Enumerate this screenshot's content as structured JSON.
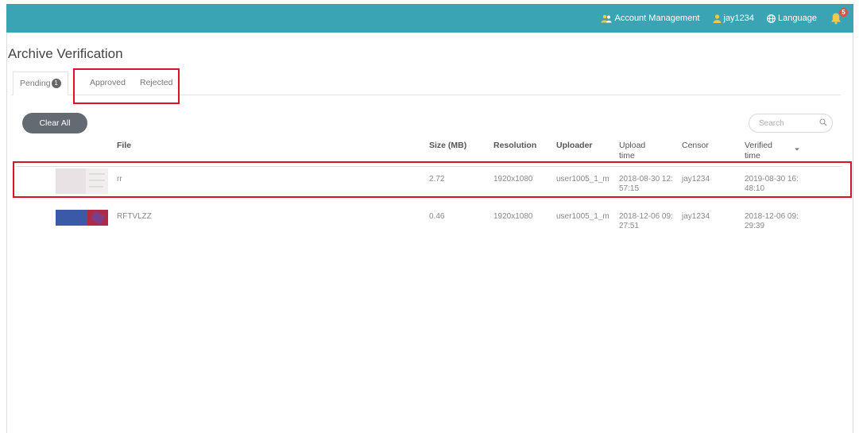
{
  "colors": {
    "topbar": "#3aa4b5",
    "highlight": "#d8132a",
    "button": "#636a72"
  },
  "topbar": {
    "account_management": "Account Management",
    "user": "jay1234",
    "language": "Language",
    "notification_count": "5",
    "icons": [
      "users-icon",
      "user-icon",
      "globe-icon",
      "bell-icon"
    ]
  },
  "page": {
    "title": "Archive Verification"
  },
  "tabs": {
    "pending": "Pending",
    "pending_count": "1",
    "approved": "Approved",
    "rejected": "Rejected"
  },
  "toolbar": {
    "clear_all": "Clear All"
  },
  "search": {
    "placeholder": "Search"
  },
  "table": {
    "headers": {
      "file": "File",
      "size": "Size (MB)",
      "resolution": "Resolution",
      "uploader": "Uploader",
      "upload_time_1": "Upload",
      "upload_time_2": "time",
      "censor": "Censor",
      "verified_time_1": "Verified",
      "verified_time_2": "time"
    },
    "rows": [
      {
        "file": "rr",
        "size": "2.72",
        "resolution": "1920x1080",
        "uploader": "user1005_1_m",
        "upload_time_1": "2018-08-30 12:",
        "upload_time_2": "57:15",
        "censor": "jay1234",
        "verified_time_1": "2019-08-30 16:",
        "verified_time_2": "48:10"
      },
      {
        "file": "RFTVLZZ",
        "size": "0.46",
        "resolution": "1920x1080",
        "uploader": "user1005_1_m",
        "upload_time_1": "2018-12-06 09:",
        "upload_time_2": "27:51",
        "censor": "jay1234",
        "verified_time_1": "2018-12-06 09:",
        "verified_time_2": "29:39"
      }
    ]
  }
}
